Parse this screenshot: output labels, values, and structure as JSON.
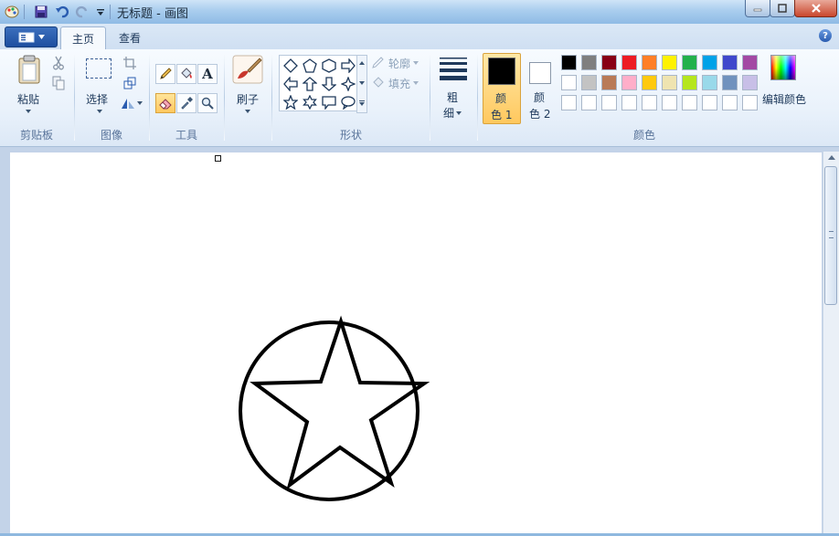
{
  "window": {
    "title": "无标题 - 画图"
  },
  "tabs": [
    {
      "label": "主页",
      "active": true
    },
    {
      "label": "查看",
      "active": false
    }
  ],
  "ribbon": {
    "clipboard": {
      "group_label": "剪贴板",
      "paste_label": "粘贴"
    },
    "image": {
      "group_label": "图像",
      "select_label": "选择"
    },
    "tools": {
      "group_label": "工具"
    },
    "brushes": {
      "label": "刷子"
    },
    "shapes": {
      "group_label": "形状",
      "outline_label": "轮廓",
      "fill_label": "填充"
    },
    "size": {
      "label_line1": "粗",
      "label_line2": "细"
    },
    "colors": {
      "group_label": "颜色",
      "color1_line1": "颜",
      "color1_line2": "色 1",
      "color2_line1": "颜",
      "color2_line2": "色 2",
      "color1_value": "#000000",
      "color2_value": "#ffffff",
      "edit_colors_label": "编辑颜色",
      "palette_row1": [
        "#000000",
        "#7f7f7f",
        "#880015",
        "#ed1c24",
        "#ff7f27",
        "#fff200",
        "#22b14c",
        "#00a2e8",
        "#3f48cc",
        "#a349a4"
      ],
      "palette_row2": [
        "#ffffff",
        "#c3c3c3",
        "#b97a57",
        "#ffaec9",
        "#ffc90e",
        "#efe4b0",
        "#b5e61d",
        "#99d9ea",
        "#7092be",
        "#c8bfe7"
      ],
      "palette_row3": [
        "#ffffff",
        "#ffffff",
        "#ffffff",
        "#ffffff",
        "#ffffff",
        "#ffffff",
        "#ffffff",
        "#ffffff",
        "#ffffff",
        "#ffffff"
      ]
    }
  },
  "icons": {
    "help": "help-icon",
    "app_menu": "app-menu-icon"
  }
}
